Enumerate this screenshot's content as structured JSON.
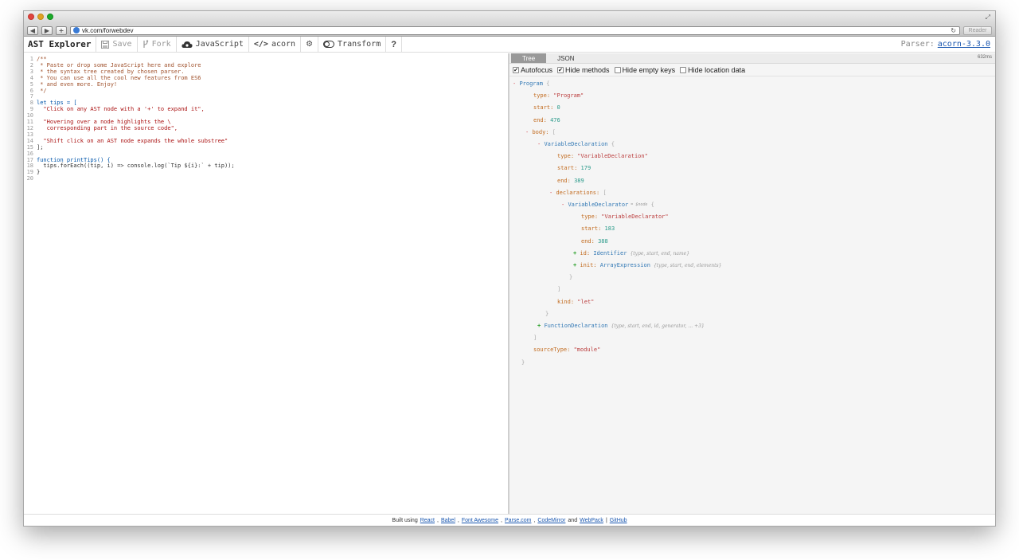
{
  "browser": {
    "url": "vk.com/forwebdev",
    "reader_label": "Reader"
  },
  "toolbar": {
    "brand": "AST Explorer",
    "save_label": "Save",
    "fork_label": "Fork",
    "language_label": "JavaScript",
    "parser_label": "acorn",
    "transform_label": "Transform",
    "help_label": "?",
    "parser_prefix": "Parser:",
    "parser_version": "acorn-3.3.0"
  },
  "editor": {
    "lines": [
      {
        "n": "1",
        "text": "/**"
      },
      {
        "n": "2",
        "text": " * Paste or drop some JavaScript here and explore"
      },
      {
        "n": "3",
        "text": " * the syntax tree created by chosen parser."
      },
      {
        "n": "4",
        "text": " * You can use all the cool new features from ES6"
      },
      {
        "n": "5",
        "text": " * and even more. Enjoy!"
      },
      {
        "n": "6",
        "text": " */"
      },
      {
        "n": "7",
        "text": ""
      },
      {
        "n": "8",
        "text": "let tips = ["
      },
      {
        "n": "9",
        "text": "  \"Click on any AST node with a '+' to expand it\","
      },
      {
        "n": "10",
        "text": ""
      },
      {
        "n": "11",
        "text": "  \"Hovering over a node highlights the \\"
      },
      {
        "n": "12",
        "text": "   corresponding part in the source code\","
      },
      {
        "n": "13",
        "text": ""
      },
      {
        "n": "14",
        "text": "  \"Shift click on an AST node expands the whole substree\""
      },
      {
        "n": "15",
        "text": "];"
      },
      {
        "n": "16",
        "text": ""
      },
      {
        "n": "17",
        "text": "function printTips() {"
      },
      {
        "n": "18",
        "text": "  tips.forEach((tip, i) => console.log(`Tip ${i}:` + tip));"
      },
      {
        "n": "19",
        "text": "}"
      },
      {
        "n": "20",
        "text": ""
      }
    ]
  },
  "output": {
    "tabs": [
      "Tree",
      "JSON"
    ],
    "timing": "632ms",
    "options": [
      {
        "label": "Autofocus",
        "checked": true
      },
      {
        "label": "Hide methods",
        "checked": true
      },
      {
        "label": "Hide empty keys",
        "checked": false
      },
      {
        "label": "Hide location data",
        "checked": false
      }
    ],
    "tree": {
      "program": "Program",
      "program_type": "\"Program\"",
      "program_start": "0",
      "program_end": "476",
      "var_decl": "VariableDeclaration",
      "var_decl_type": "\"VariableDeclaration\"",
      "var_decl_start": "179",
      "var_decl_end": "389",
      "declarator": "VariableDeclarator",
      "declarator_anno": "= $node",
      "declarator_type": "\"VariableDeclarator\"",
      "declarator_start": "183",
      "declarator_end": "388",
      "id_node": "Identifier",
      "id_summary": "{type, start, end, name}",
      "init_node": "ArrayExpression",
      "init_summary": "{type, start, end, elements}",
      "kind": "\"let\"",
      "func_node": "FunctionDeclaration",
      "func_summary": "{type, start, end, id, generator, ... +3}",
      "source_type": "\"module\""
    }
  },
  "footer": {
    "prefix": "Built using",
    "links": [
      "React",
      "Babel",
      "Font Awesome",
      "Parse.com",
      "CodeMirror",
      "WebPack",
      "GitHub"
    ],
    "and": "and",
    "sep": "|"
  }
}
